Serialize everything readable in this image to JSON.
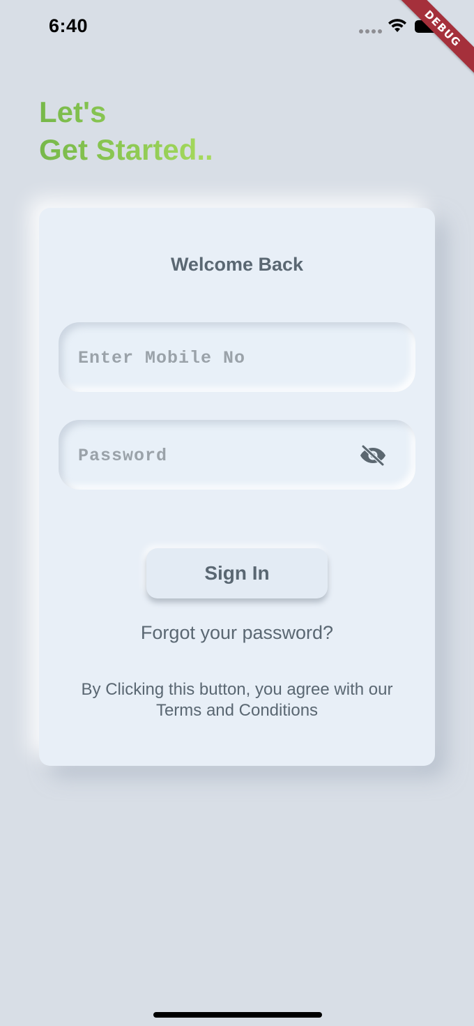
{
  "status_bar": {
    "time": "6:40"
  },
  "debug_banner": "DEBUG",
  "heading": {
    "line1": "Let's",
    "line2": "Get Started..",
    "colors": [
      "#77b84a",
      "#a8db5c"
    ]
  },
  "card": {
    "title": "Welcome Back",
    "mobile_field": {
      "placeholder": "Enter Mobile No",
      "value": ""
    },
    "password_field": {
      "placeholder": "Password",
      "value": "",
      "visibility_icon": "eye-off-icon"
    },
    "sign_in_label": "Sign In",
    "forgot_password_label": "Forgot your password?",
    "terms_line1": "By Clicking this button, you agree with our",
    "terms_line2": "Terms and Conditions"
  },
  "colors": {
    "background": "#d8dee6",
    "card": "#e8eff7",
    "text": "#5a6772",
    "accent_green": "#86c04e",
    "debug_red": "#a5303b"
  }
}
